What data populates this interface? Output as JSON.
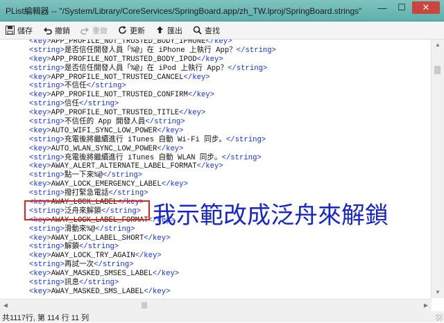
{
  "window": {
    "title": "PList編輯器  --  \"/System/Library/CoreServices/SpringBoard.app/zh_TW.lproj/SpringBoard.strings\"",
    "buttons": {
      "minimize": "—",
      "maximize": "☐",
      "close": "✕"
    }
  },
  "toolbar": {
    "save": {
      "label": "儲存",
      "icon": "save-icon"
    },
    "undo": {
      "label": "撤銷",
      "icon": "undo-icon"
    },
    "redo": {
      "label": "重做",
      "icon": "redo-icon"
    },
    "refresh": {
      "label": "更新",
      "icon": "refresh-icon"
    },
    "export": {
      "label": "匯出",
      "icon": "export-icon"
    },
    "find": {
      "label": "查找",
      "icon": "search-icon"
    }
  },
  "editor": {
    "lines": [
      {
        "type": "key",
        "text": "APP_PROFILE_NOT_TRUSTED_BODY_IPHONE"
      },
      {
        "type": "string",
        "text": "是否信任開發人員「%@」在 iPhone 上執行 App？"
      },
      {
        "type": "key",
        "text": "APP_PROFILE_NOT_TRUSTED_BODY_IPOD"
      },
      {
        "type": "string",
        "text": "是否信任開發人員「%@」在 iPod 上執行 App？"
      },
      {
        "type": "key",
        "text": "APP_PROFILE_NOT_TRUSTED_CANCEL"
      },
      {
        "type": "string",
        "text": "不信任"
      },
      {
        "type": "key",
        "text": "APP_PROFILE_NOT_TRUSTED_CONFIRM"
      },
      {
        "type": "string",
        "text": "信任"
      },
      {
        "type": "key",
        "text": "APP_PROFILE_NOT_TRUSTED_TITLE"
      },
      {
        "type": "string",
        "text": "不信任的 App 開發人員"
      },
      {
        "type": "key",
        "text": "AUTO_WIFI_SYNC_LOW_POWER"
      },
      {
        "type": "string",
        "text": "充電後將繼續進行 iTunes 自動 Wi-Fi 同步。"
      },
      {
        "type": "key",
        "text": "AUTO_WLAN_SYNC_LOW_POWER"
      },
      {
        "type": "string",
        "text": "充電後將繼續進行 iTunes 自動 WLAN 同步。"
      },
      {
        "type": "key",
        "text": "AWAY_ALERT_ALTERNATE_LABEL_FORMAT"
      },
      {
        "type": "string",
        "text": "點一下來%@"
      },
      {
        "type": "key",
        "text": "AWAY_LOCK_EMERGENCY_LABEL"
      },
      {
        "type": "string",
        "text": "撥打緊急電話"
      },
      {
        "type": "key",
        "text": "AWAY_LOCK_LABEL"
      },
      {
        "type": "string",
        "text": "泛舟來解鎖"
      },
      {
        "type": "key",
        "text": "AWAY_LOCK_LABEL_FORMAT"
      },
      {
        "type": "string",
        "text": "滑動來%@"
      },
      {
        "type": "key",
        "text": "AWAY_LOCK_LABEL_SHORT"
      },
      {
        "type": "string",
        "text": "解鎖"
      },
      {
        "type": "key",
        "text": "AWAY_LOCK_TRY_AGAIN"
      },
      {
        "type": "string",
        "text": "再試一次"
      },
      {
        "type": "key",
        "text": "AWAY_MASKED_SMSES_LABEL"
      },
      {
        "type": "string",
        "text": "訊息"
      },
      {
        "type": "key",
        "text": "AWAY_MASKED_SMS_LABEL"
      }
    ]
  },
  "annotation": {
    "text": "我示範改成泛舟來解鎖",
    "color": "#1525c9",
    "box_color": "#e0221c"
  },
  "status": {
    "text": "共1117行,  第 114 行 11 列"
  }
}
